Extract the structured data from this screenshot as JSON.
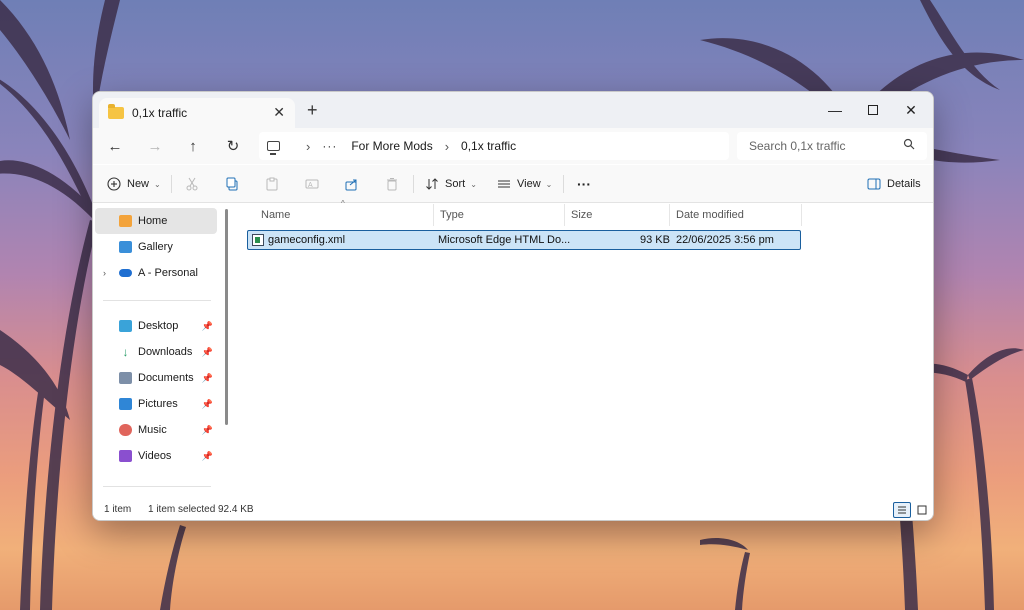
{
  "window": {
    "tab_title": "0,1x traffic",
    "tab_close": "✕",
    "new_tab": "+",
    "minimize": "—",
    "close": "✕"
  },
  "address": {
    "back": "←",
    "forward": "→",
    "up": "↑",
    "refresh": "↻",
    "more": "···",
    "separator": "›",
    "crumbs": [
      "For More Mods",
      "0,1x traffic"
    ],
    "search_placeholder": "Search 0,1x traffic"
  },
  "toolbar": {
    "new_label": "New",
    "sort_label": "Sort",
    "view_label": "View",
    "more": "···",
    "details_label": "Details",
    "caret": "⌄",
    "disabled": [
      "cut-icon",
      "paste-icon",
      "rename-icon",
      "delete-icon"
    ],
    "enabled": [
      "copy-icon",
      "share-icon"
    ]
  },
  "sidebar": {
    "top": [
      {
        "label": "Home",
        "icon": "home-icon",
        "active": true
      },
      {
        "label": "Gallery",
        "icon": "gallery-icon"
      },
      {
        "label": "A - Personal",
        "icon": "onedrive-icon",
        "expandable": true
      }
    ],
    "quick_access": [
      {
        "label": "Desktop",
        "icon": "desktop-icon",
        "pinned": true
      },
      {
        "label": "Downloads",
        "icon": "downloads-icon",
        "pinned": true
      },
      {
        "label": "Documents",
        "icon": "documents-icon",
        "pinned": true
      },
      {
        "label": "Pictures",
        "icon": "pictures-icon",
        "pinned": true
      },
      {
        "label": "Music",
        "icon": "music-icon",
        "pinned": true
      },
      {
        "label": "Videos",
        "icon": "videos-icon",
        "pinned": true
      }
    ],
    "expand_glyph": "›",
    "pin_glyph": "📌"
  },
  "files": {
    "columns": [
      "Name",
      "Type",
      "Size",
      "Date modified"
    ],
    "sort_glyph": "^",
    "rows": [
      {
        "name": "gameconfig.xml",
        "type": "Microsoft Edge HTML Do...",
        "size": "93 KB",
        "date": "22/06/2025 3:56 pm",
        "selected": true
      }
    ]
  },
  "status": {
    "count": "1 item",
    "selection": "1 item selected",
    "size": "92.4 KB"
  },
  "colors": {
    "selection_bg": "#cce4f7",
    "selection_border": "#1a5f9e",
    "folder": "#f6c443"
  }
}
